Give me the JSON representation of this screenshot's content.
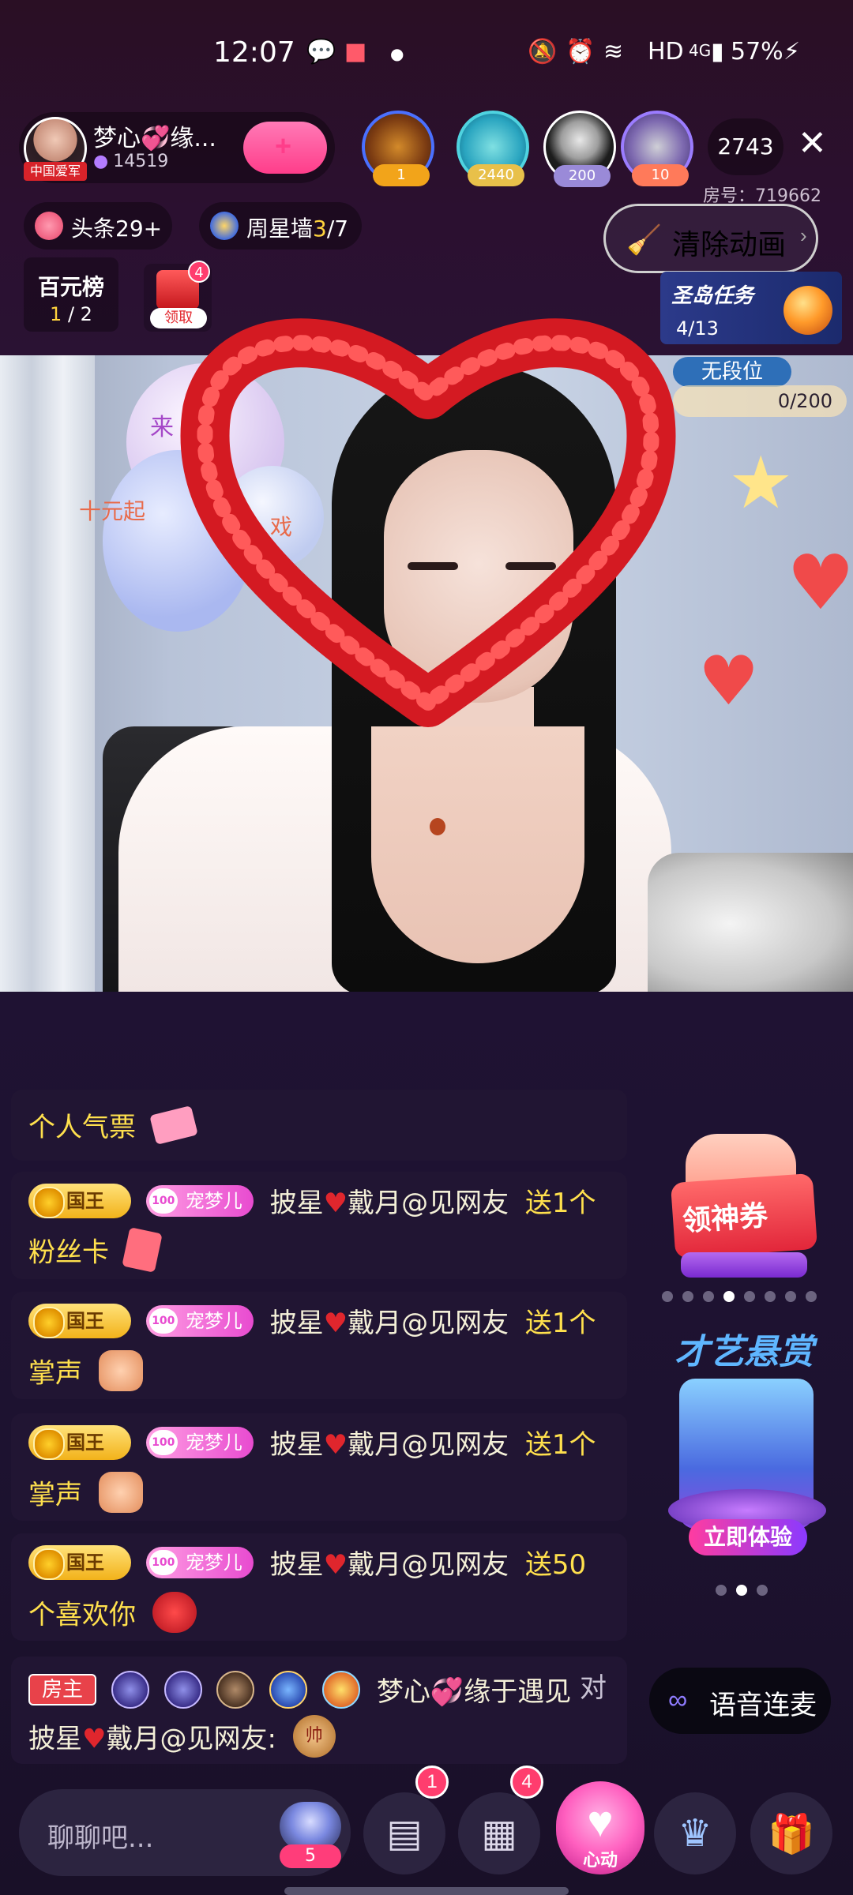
{
  "status_bar": {
    "time": "12:07",
    "network": "HD",
    "signal": "4G",
    "battery": "57%"
  },
  "host": {
    "name": "梦心💞缘...",
    "followers": "14519",
    "avatar_tag": "中国爱军"
  },
  "viewers": [
    {
      "badge": "1",
      "color": "#f2a41a"
    },
    {
      "badge": "2440",
      "color": "#f2c34a"
    },
    {
      "badge": "200",
      "color": "#9a8ad8"
    },
    {
      "badge": "10",
      "color": "#ff7a5a"
    }
  ],
  "viewer_count": "2743",
  "room_number": "房号：719662",
  "chips": {
    "headline": "头条29+",
    "weekly_star_label": "周星墙",
    "weekly_star_current": "3",
    "weekly_star_total": "/7"
  },
  "clear_animation_label": "清除动画",
  "rank_card": {
    "title": "百元榜",
    "current": "1",
    "total": " / 2"
  },
  "gift_box": {
    "badge": "4",
    "label": "领取"
  },
  "task_card": {
    "title": "圣岛任务",
    "progress": "4/13"
  },
  "video": {
    "wall_text_1": "来",
    "wall_text_2": "十元起",
    "wall_text_3": "戏"
  },
  "guest_slot": {
    "label": "无段位",
    "value": "0/200"
  },
  "chat": {
    "partial_top": {
      "text": "个人气票"
    },
    "messages": [
      {
        "level": "国王",
        "fan": "宠梦儿",
        "user_a": "披星",
        "user_b": "戴月@见网友",
        "gift_line1": "送1个",
        "gift_line2": "粉丝卡"
      },
      {
        "level": "国王",
        "fan": "宠梦儿",
        "user_a": "披星",
        "user_b": "戴月@见网友",
        "gift_line1": "送1个",
        "gift_line2": "掌声"
      },
      {
        "level": "国王",
        "fan": "宠梦儿",
        "user_a": "披星",
        "user_b": "戴月@见网友",
        "gift_line1": "送1个",
        "gift_line2": "掌声"
      },
      {
        "level": "国王",
        "fan": "宠梦儿",
        "user_a": "披星",
        "user_b": "戴月@见网友",
        "gift_line1": "送50",
        "gift_line2": "个喜欢你"
      }
    ],
    "owner_message": {
      "badge": "房主",
      "name": "梦心💞缘于遇见",
      "to": "对",
      "target_a": "披星",
      "target_b": "戴月@见网友:",
      "coin_text": "帅"
    }
  },
  "promos": {
    "coupon_label": "领神券",
    "talent_title": "才艺悬赏",
    "talent_button": "立即体验"
  },
  "voice_button": "语音连麦",
  "bottom_bar": {
    "chat_placeholder": "聊聊吧...",
    "avatar_badge": "5",
    "message_badge": "1",
    "apps_badge": "4",
    "heart_label": "心动"
  }
}
